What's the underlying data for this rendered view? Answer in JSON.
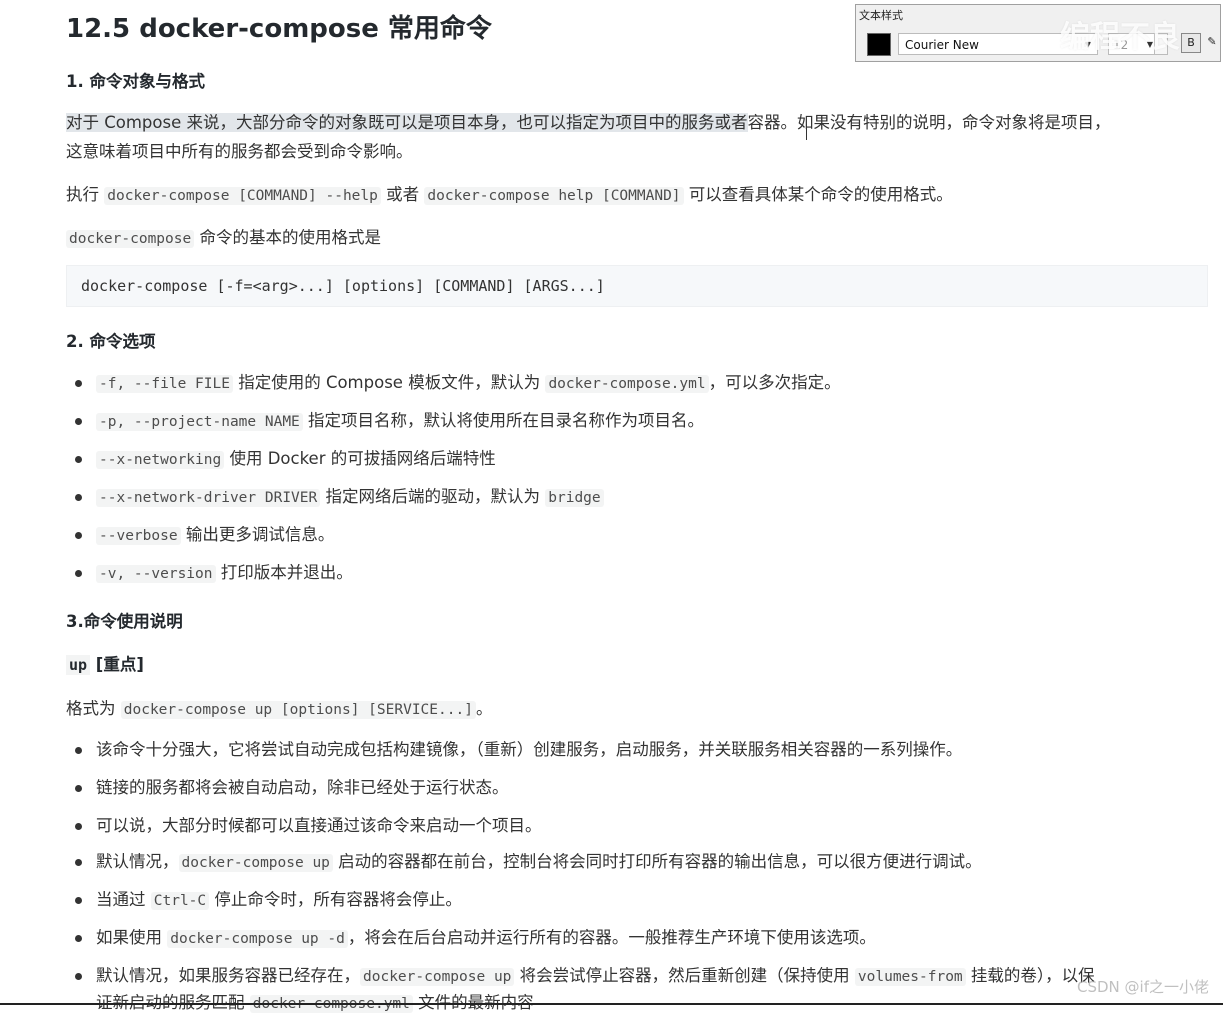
{
  "doc": {
    "title": "12.5 docker-compose 常用命令",
    "s1": {
      "heading": "1. 命令对象与格式",
      "p1_highlight": "对于 Compose 来说，大部分命令的对象既可以是项目本身，也可以指定为项目中的服务或者",
      "p1_rest": "容器。如果没有特别的说明，命令对象将是项目，",
      "p1_line2": "这意味着项目中所有的服务都会受到命令影响。",
      "p2_pre": "执行 ",
      "p2_code1": "docker-compose [COMMAND] --help",
      "p2_mid": " 或者 ",
      "p2_code2": "docker-compose help [COMMAND]",
      "p2_post": " 可以查看具体某个命令的使用格式。",
      "p3_code": "docker-compose",
      "p3_text": " 命令的基本的使用格式是",
      "code_block": "docker-compose [-f=<arg>...] [options] [COMMAND] [ARGS...]"
    },
    "s2": {
      "heading": "2. 命令选项",
      "items": [
        {
          "code": "-f, --file FILE",
          "text": " 指定使用的 Compose 模板文件，默认为 ",
          "code2": "docker-compose.yml",
          "text2": "，可以多次指定。"
        },
        {
          "code": "-p, --project-name NAME",
          "text": " 指定项目名称，默认将使用所在目录名称作为项目名。"
        },
        {
          "code": "--x-networking",
          "text": " 使用 Docker 的可拔插网络后端特性"
        },
        {
          "code": "--x-network-driver DRIVER",
          "text": " 指定网络后端的驱动，默认为 ",
          "code2": "bridge"
        },
        {
          "code": "--verbose",
          "text": " 输出更多调试信息。"
        },
        {
          "code": "-v, --version",
          "text": " 打印版本并退出。"
        }
      ]
    },
    "s3": {
      "heading": "3.命令使用说明",
      "up_code": "up",
      "up_text": " [重点]",
      "fmt_pre": "格式为 ",
      "fmt_code": "docker-compose up [options] [SERVICE...]",
      "fmt_post": "。",
      "items": [
        {
          "text": "该命令十分强大，它将尝试自动完成包括构建镜像，（重新）创建服务，启动服务，并关联服务相关容器的一系列操作。"
        },
        {
          "text": "链接的服务都将会被自动启动，除非已经处于运行状态。"
        },
        {
          "text": "可以说，大部分时候都可以直接通过该命令来启动一个项目。"
        },
        {
          "pre": "默认情况，",
          "code": "docker-compose up",
          "text": " 启动的容器都在前台，控制台将会同时打印所有容器的输出信息，可以很方便进行调试。"
        },
        {
          "pre": "当通过 ",
          "code": "Ctrl-C",
          "text": " 停止命令时，所有容器将会停止。"
        },
        {
          "pre": "如果使用 ",
          "code": "docker-compose up -d",
          "text": "，将会在后台启动并运行所有的容器。一般推荐生产环境下使用该选项。"
        },
        {
          "pre": "默认情况，如果服务容器已经存在，",
          "code": "docker-compose up",
          "text": " 将会尝试停止容器，然后重新创建（保持使用 ",
          "code2": "volumes-from",
          "text2": " 挂载的卷），以保",
          "line2_pre": "证新启动的服务匹配 ",
          "line2_code": "docker-compose.yml",
          "line2_text": " 文件的最新内容"
        }
      ]
    }
  },
  "toolbar": {
    "title": "文本样式",
    "font": "Courier New",
    "size": "12",
    "color": "#000000"
  },
  "watermark": {
    "top": "编程不良",
    "bottom": "CSDN @if之一小佬"
  }
}
